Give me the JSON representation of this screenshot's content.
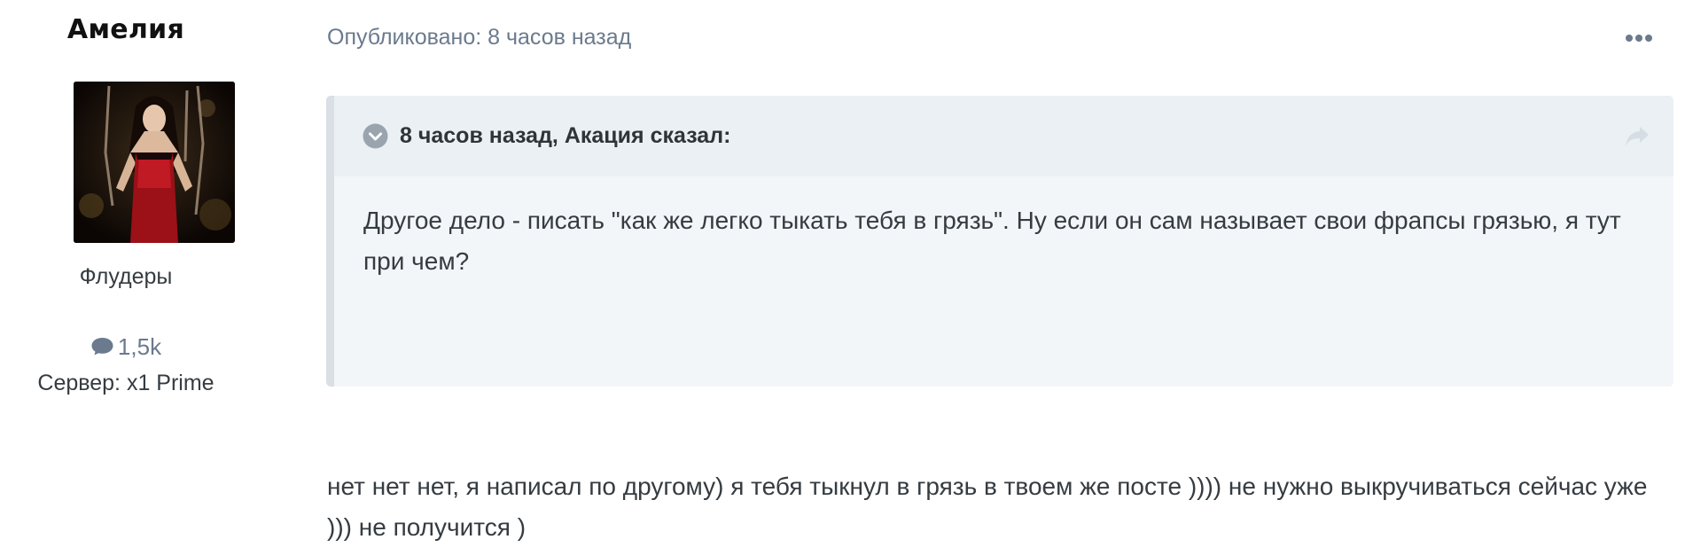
{
  "author": {
    "name": "Амелия",
    "group": "Флудеры",
    "posts_count": "1,5k",
    "server": "Сервер: x1 Prime",
    "comment_icon": "comment-icon"
  },
  "post": {
    "published": "Опубликовано: 8 часов назад",
    "menu_icon": "ellipsis-icon",
    "quote": {
      "citation": "8 часов назад, Акация сказал:",
      "toggle_icon": "chevron-down-circle-icon",
      "share_icon": "share-arrow-icon",
      "text": "Другое дело - писать \"как же легко тыкать тебя в грязь\". Ну если он сам называет свои фрапсы грязью, я тут при чем?"
    },
    "text": "нет нет нет, я написал по другому) я тебя тыкнул в грязь в твоем же посте )))) не нужно выкручиваться сейчас уже ))) не получится )"
  },
  "colors": {
    "meta_text": "#6b7a8d",
    "quote_bg": "#f3f6f9",
    "quote_header_bg": "#ebf0f4",
    "quote_border": "#d9dfe5",
    "body_text": "#353c41"
  }
}
